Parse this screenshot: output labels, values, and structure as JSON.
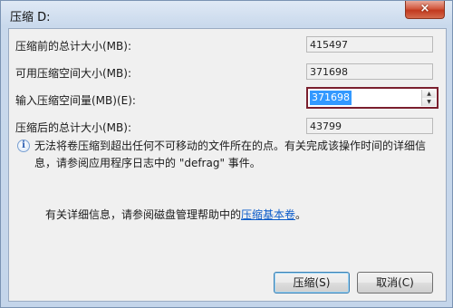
{
  "window": {
    "title": "压缩 D:",
    "close_glyph": "×"
  },
  "fields": {
    "total_before_label": "压缩前的总计大小(MB):",
    "total_before_value": "415497",
    "available_label": "可用压缩空间大小(MB):",
    "available_value": "371698",
    "input_label": "输入压缩空间量(MB)(E):",
    "input_value": "371698",
    "total_after_label": "压缩后的总计大小(MB):",
    "total_after_value": "43799"
  },
  "info": {
    "icon": "info-icon",
    "text": "无法将卷压缩到超出任何不可移动的文件所在的点。有关完成该操作时间的详细信息，请参阅应用程序日志中的 \"defrag\" 事件。"
  },
  "help": {
    "prefix": "有关详细信息，请参阅磁盘管理帮助中的",
    "link_text": "压缩基本卷",
    "suffix": "。"
  },
  "buttons": {
    "shrink_label": "压缩(S)",
    "cancel_label": "取消(C)"
  }
}
